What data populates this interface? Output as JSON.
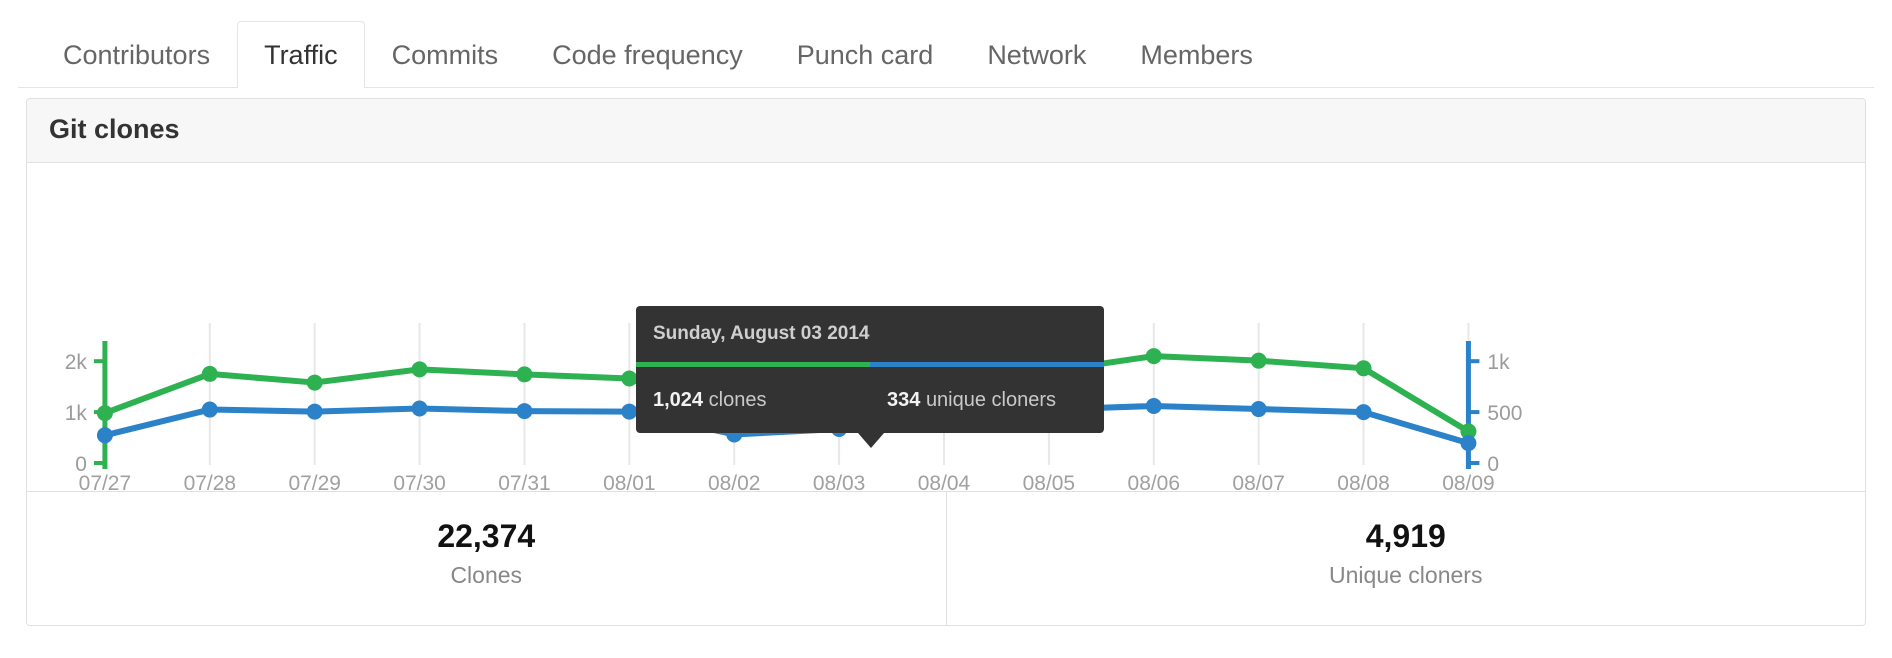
{
  "tabs": [
    {
      "label": "Contributors",
      "selected": false
    },
    {
      "label": "Traffic",
      "selected": true
    },
    {
      "label": "Commits",
      "selected": false
    },
    {
      "label": "Code frequency",
      "selected": false
    },
    {
      "label": "Punch card",
      "selected": false
    },
    {
      "label": "Network",
      "selected": false
    },
    {
      "label": "Members",
      "selected": false
    }
  ],
  "panel": {
    "title": "Git clones"
  },
  "tooltip": {
    "date": "Sunday, August 03 2014",
    "clones_value": "1,024",
    "clones_label": "clones",
    "uniques_value": "334",
    "uniques_label": "unique cloners",
    "series_colors": {
      "clones": "#2eb150",
      "uniques": "#2c82c9"
    }
  },
  "summary": [
    {
      "value": "22,374",
      "label": "Clones"
    },
    {
      "value": "4,919",
      "label": "Unique cloners"
    }
  ],
  "chart_data": {
    "type": "line",
    "title": "Git clones",
    "xlabel": "",
    "ylabel": "Clones",
    "grid": true,
    "legend": "none",
    "dual_axis": true,
    "categories": [
      "07/27",
      "07/28",
      "07/29",
      "07/30",
      "07/31",
      "08/01",
      "08/02",
      "08/03",
      "08/04",
      "08/05",
      "08/06",
      "08/07",
      "08/08",
      "08/09"
    ],
    "left_axis": {
      "name": "Clones",
      "color": "#2eb150",
      "ticks": [
        "0",
        "1k",
        "2k"
      ],
      "tick_values": [
        0,
        1000,
        2000
      ],
      "ylim": [
        0,
        2200
      ]
    },
    "right_axis": {
      "name": "Unique cloners",
      "color": "#2c82c9",
      "ticks": [
        "0",
        "500",
        "1k"
      ],
      "tick_values": [
        0,
        500,
        1000
      ],
      "ylim": [
        0,
        1100
      ]
    },
    "series": [
      {
        "name": "Clones",
        "color": "#2eb150",
        "axis": "left",
        "values": [
          980,
          1750,
          1580,
          1840,
          1740,
          1660,
          930,
          1024,
          1570,
          1800,
          2100,
          2010,
          1860,
          620
        ]
      },
      {
        "name": "Unique cloners",
        "color": "#2c82c9",
        "axis": "right",
        "values": [
          272,
          525,
          505,
          535,
          510,
          505,
          280,
          334,
          510,
          525,
          560,
          530,
          500,
          195
        ]
      }
    ],
    "annotations": [
      {
        "x": "08/03",
        "clones": 1024,
        "unique_cloners": 334,
        "label": "Sunday, August 03 2014"
      }
    ],
    "totals": {
      "clones": 22374,
      "unique_cloners": 4919
    }
  }
}
